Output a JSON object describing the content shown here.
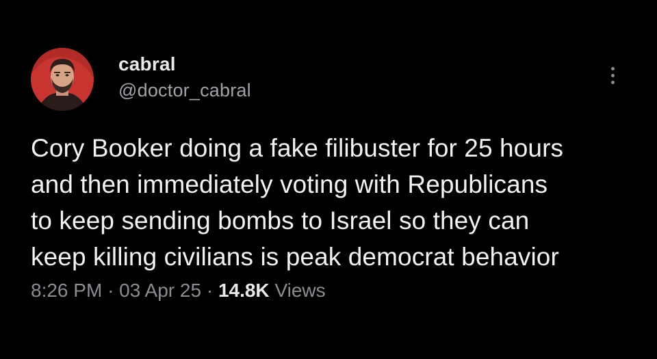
{
  "user": {
    "display_name": "cabral",
    "handle": "@doctor_cabral",
    "avatar_icon": "profile-avatar-image"
  },
  "menu": {
    "more_icon": "more-vertical-icon"
  },
  "tweet": {
    "lines": [
      "Cory Booker doing a fake filibuster for 25 hours",
      "and then immediately voting with Republicans",
      "to keep sending bombs to Israel so they can",
      "keep killing civilians is peak democrat behavior"
    ]
  },
  "meta": {
    "time": "8:26 PM",
    "separator": "·",
    "date": "03 Apr 25",
    "views_count": "14.8K",
    "views_label": "Views"
  },
  "colors": {
    "background": "#000000",
    "primary_text": "#e7e9ea",
    "secondary_text": "#8a8e93",
    "avatar_bg": "#c8342f"
  }
}
